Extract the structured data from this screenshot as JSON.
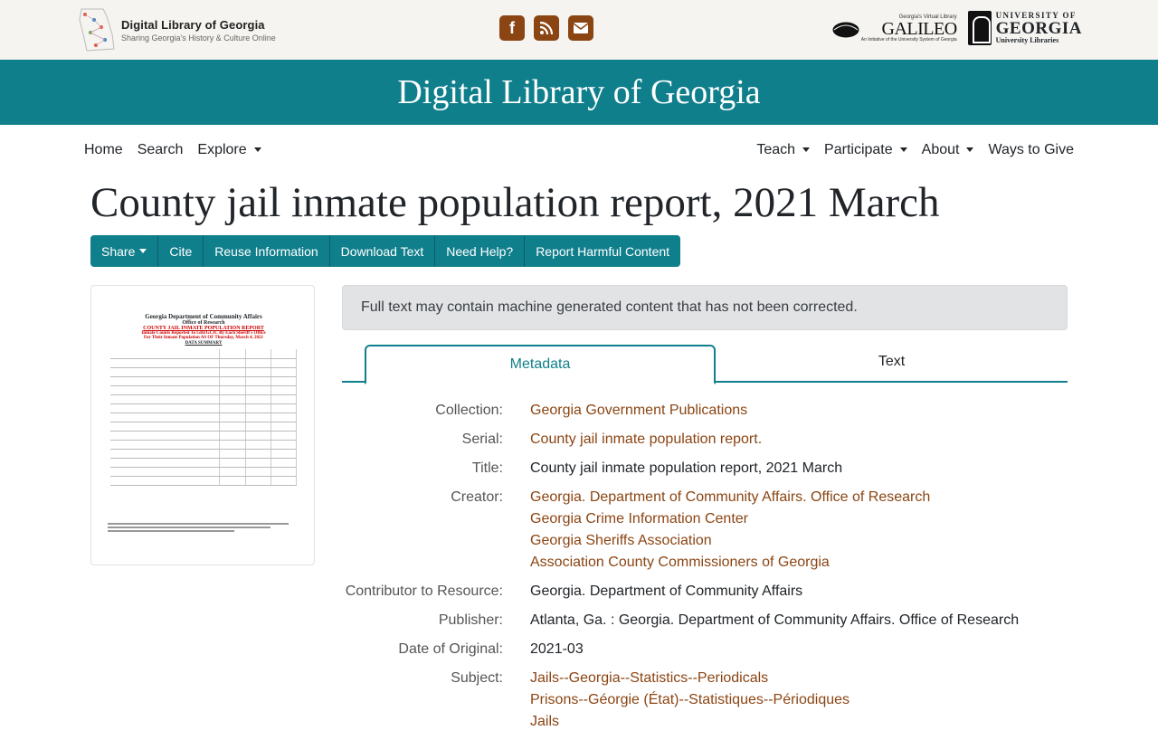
{
  "header": {
    "brand_title": "Digital Library of Georgia",
    "brand_subtitle": "Sharing Georgia's History & Culture Online",
    "social_icons": [
      "facebook-icon",
      "rss-icon",
      "email-icon"
    ],
    "galileo_small": "Georgia's Virtual Library",
    "galileo_name": "GALILEO",
    "galileo_tag": "An Initiative of the University System of Georgia",
    "uga_line1": "UNIVERSITY OF",
    "uga_line2": "GEORGIA",
    "uga_line3": "University Libraries"
  },
  "banner": {
    "title": "Digital Library of Georgia"
  },
  "nav": {
    "home": "Home",
    "search": "Search",
    "explore": "Explore",
    "teach": "Teach",
    "participate": "Participate",
    "about": "About",
    "give": "Ways to Give"
  },
  "page_title": "County jail inmate population report, 2021 March",
  "toolbar": {
    "share": "Share",
    "cite": "Cite",
    "reuse": "Reuse Information",
    "download": "Download Text",
    "help": "Need Help?",
    "report": "Report Harmful Content"
  },
  "thumbnail": {
    "line1": "Georgia Department of Community Affairs",
    "line2": "Office of Research",
    "line3": "COUNTY JAIL INMATE POPULATION REPORT",
    "line4": "Inmate Counts Reported To GBI/GCIC By Each Sheriff's Office",
    "line5": "For Their Inmate Population AS OF Thursday, March 4, 2021",
    "line6": "DATA SUMMARY"
  },
  "alert": "Full text may contain machine generated content that has not been corrected.",
  "tabs": {
    "metadata": "Metadata",
    "text": "Text"
  },
  "metadata": {
    "collection_label": "Collection:",
    "collection": "Georgia Government Publications",
    "serial_label": "Serial:",
    "serial": "County jail inmate population report.",
    "title_label": "Title:",
    "title": "County jail inmate population report, 2021 March",
    "creator_label": "Creator:",
    "creators": [
      "Georgia. Department of Community Affairs. Office of Research",
      "Georgia Crime Information Center",
      "Georgia Sheriffs Association",
      "Association County Commissioners of Georgia"
    ],
    "contributor_label": "Contributor to Resource:",
    "contributor": "Georgia. Department of Community Affairs",
    "publisher_label": "Publisher:",
    "publisher": "Atlanta, Ga. : Georgia. Department of Community Affairs. Office of Research",
    "date_label": "Date of Original:",
    "date": "2021-03",
    "subject_label": "Subject:",
    "subjects": [
      "Jails--Georgia--Statistics--Periodicals",
      "Prisons--Géorgie (État)--Statistiques--Périodiques",
      "Jails"
    ]
  },
  "colors": {
    "teal": "#107f8c",
    "link_brown": "#8b4513"
  }
}
